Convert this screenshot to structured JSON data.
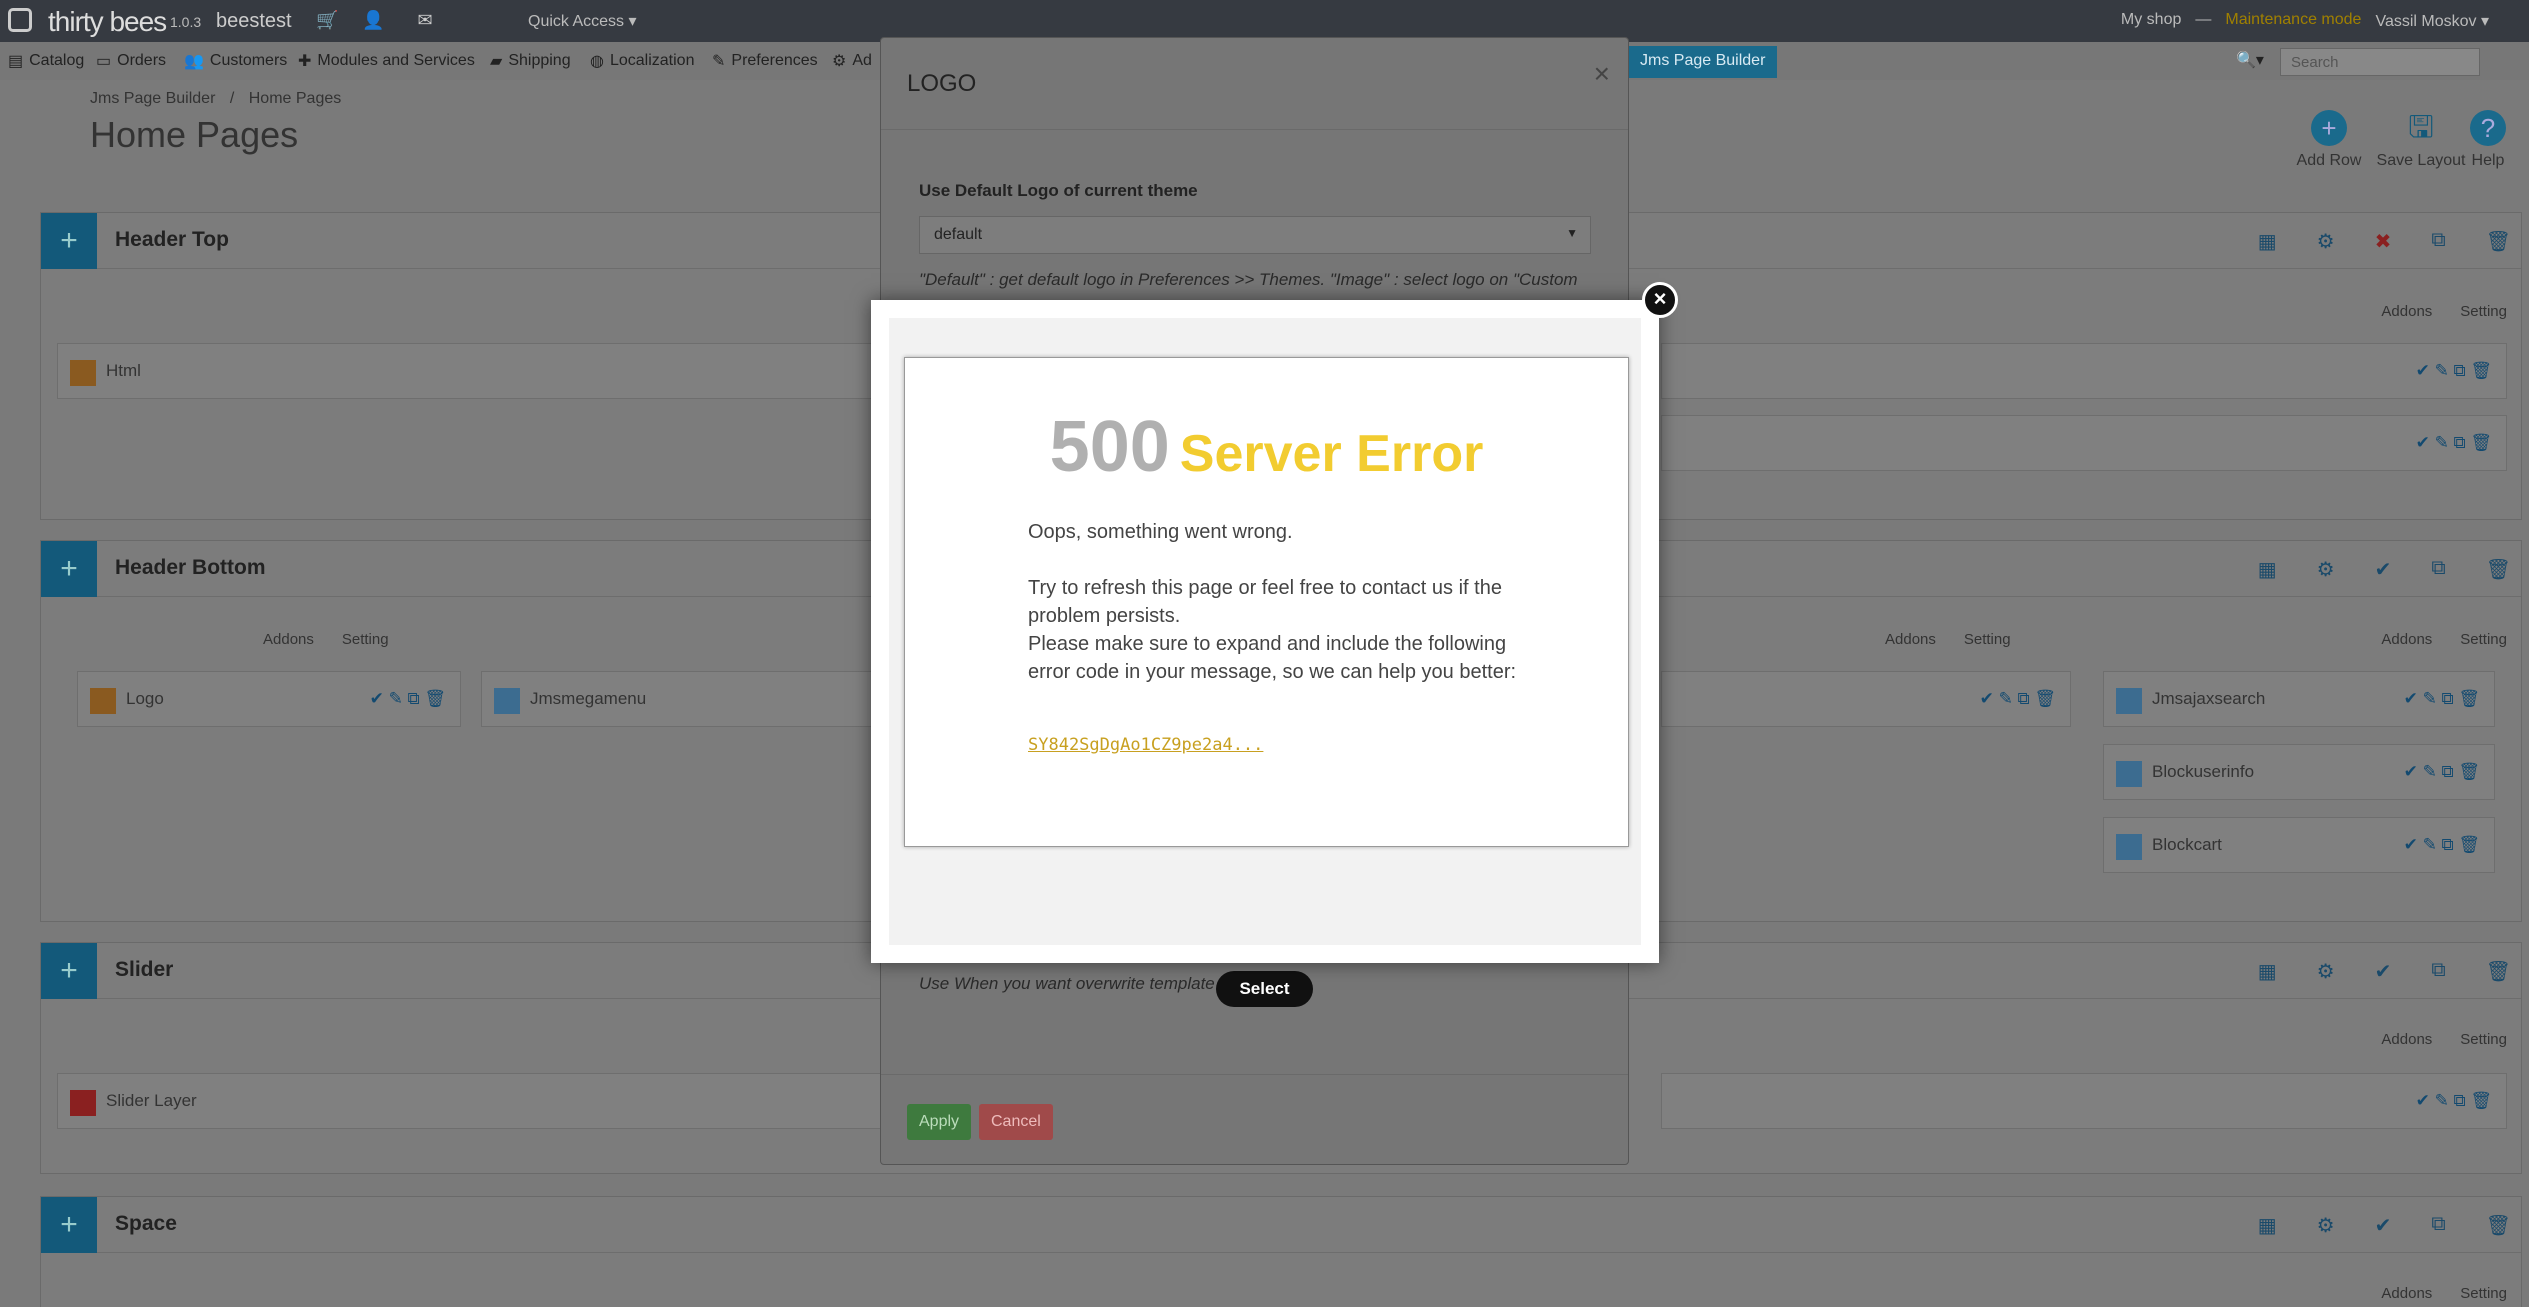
{
  "topbar": {
    "brand": "thirty bees",
    "version": "1.0.3",
    "shop_name": "beestest",
    "quick_access": "Quick Access ▾",
    "my_shop": "My shop",
    "separator": "—",
    "maintenance": "Maintenance mode",
    "user": "Vassil Moskov ▾"
  },
  "nav": {
    "items": [
      "Catalog",
      "Orders",
      "Customers",
      "Modules and Services",
      "Shipping",
      "Localization",
      "Preferences",
      "Ad"
    ],
    "active": "Jms Page Builder",
    "search_placeholder": "Search"
  },
  "breadcrumb": {
    "parent": "Jms Page Builder",
    "sep": "/",
    "current": "Home Pages"
  },
  "page_title": "Home Pages",
  "toolbar": {
    "add_row": "Add Row",
    "save_layout": "Save Layout",
    "help": "Help"
  },
  "sections": {
    "header_top": {
      "title": "Header Top",
      "block": "Html"
    },
    "header_bottom": {
      "title": "Header Bottom",
      "col1": "Logo",
      "col2": "Jmsmegamenu",
      "col4a": "Jmsajaxsearch",
      "col4b": "Blockuserinfo",
      "col4c": "Blockcart"
    },
    "slider": {
      "title": "Slider",
      "block": "Slider Layer"
    },
    "space": {
      "title": "Space"
    },
    "addons": "Addons",
    "setting": "Setting"
  },
  "logo_modal": {
    "title": "LOGO",
    "close": "×",
    "label": "Use Default Logo of current theme",
    "select_value": "default",
    "hint": "\"Default\" : get default logo in Preferences >> Themes. \"Image\" : select logo on \"Custom",
    "hint2": "Use When you want overwrite template",
    "apply": "Apply",
    "cancel": "Cancel"
  },
  "select_button": "Select",
  "error_modal": {
    "code": "500",
    "title": "Server Error",
    "line1": "Oops, something went wrong.",
    "line2": "Try to refresh this page or feel free to contact us if the problem persists.",
    "line3": "Please make sure to expand and include the following error code in your message, so we can help you better:",
    "error_code": "SY842SgDgAo1CZ9pe2a4...",
    "close": "×"
  }
}
